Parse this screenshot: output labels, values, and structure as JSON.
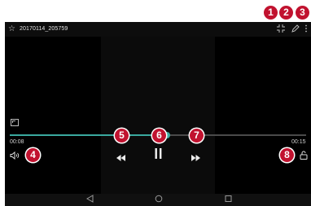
{
  "header": {
    "file_title": "20170114_205759",
    "favorite_icon": "star-outline-icon",
    "exit_fullscreen_icon": "exit-fullscreen-icon",
    "edit_icon": "pencil-icon",
    "menu_icon": "more-vertical-icon"
  },
  "playback": {
    "elapsed": "00:08",
    "duration": "00:15",
    "progress_fraction": 0.53
  },
  "controls": {
    "volume_icon": "volume-icon",
    "rewind_icon": "rewind-icon",
    "pause_icon": "pause-icon",
    "fast_forward_icon": "fast-forward-icon",
    "lock_icon": "unlock-icon",
    "aspect_icon": "aspect-ratio-icon"
  },
  "callouts": [
    "1",
    "2",
    "3",
    "4",
    "5",
    "6",
    "7",
    "8"
  ],
  "colors": {
    "progress": "#3aa99f",
    "callout": "#c1122f"
  },
  "nav": {
    "back_icon": "back-icon",
    "home_icon": "home-icon",
    "recents_icon": "recents-icon"
  }
}
